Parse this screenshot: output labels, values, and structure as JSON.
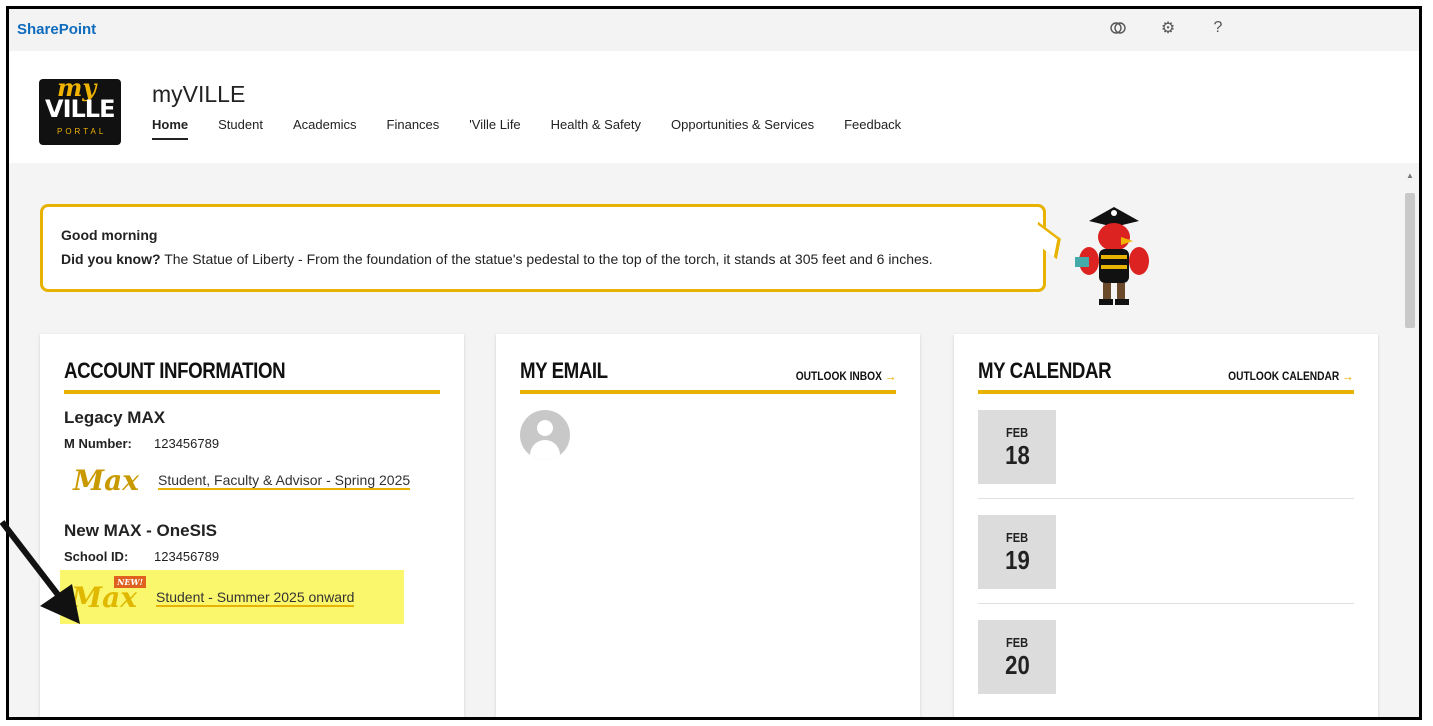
{
  "suitebar": {
    "brand": "SharePoint",
    "icons": [
      "teams-icon",
      "gear-icon",
      "help-icon"
    ]
  },
  "site": {
    "logo": {
      "my": "my",
      "ville": "VILLE",
      "portal": "PORTAL"
    },
    "title": "myVILLE",
    "nav": [
      {
        "label": "Home",
        "active": true
      },
      {
        "label": "Student"
      },
      {
        "label": "Academics"
      },
      {
        "label": "Finances"
      },
      {
        "label": "'Ville Life"
      },
      {
        "label": "Health & Safety"
      },
      {
        "label": "Opportunities & Services"
      },
      {
        "label": "Feedback"
      }
    ]
  },
  "greeting": {
    "salutation": "Good morning",
    "fact_label": "Did you know?",
    "fact_text": " The Statue of Liberty - From the foundation of the statue's pedestal to the top of the torch, it stands at 305 feet and 6 inches."
  },
  "account": {
    "title": "ACCOUNT INFORMATION",
    "legacy": {
      "heading": "Legacy MAX",
      "id_label": "M Number:",
      "id_value": "123456789",
      "logo_text": "Max",
      "link": "Student, Faculty & Advisor - Spring 2025"
    },
    "onesis": {
      "heading": "New MAX - OneSIS",
      "id_label": "School ID:",
      "id_value": "123456789",
      "logo_text": "Max",
      "new_tag": "NEW!",
      "link": "Student - Summer 2025 onward"
    }
  },
  "email": {
    "title": "MY EMAIL",
    "link": "OUTLOOK INBOX"
  },
  "calendar": {
    "title": "MY CALENDAR",
    "link": "OUTLOOK CALENDAR",
    "dates": [
      {
        "month": "FEB",
        "day": "18"
      },
      {
        "month": "FEB",
        "day": "19"
      },
      {
        "month": "FEB",
        "day": "20"
      }
    ]
  },
  "colors": {
    "accent": "#e8b300",
    "highlight": "#fbf76c",
    "brand_blue": "#0f6cbd"
  }
}
